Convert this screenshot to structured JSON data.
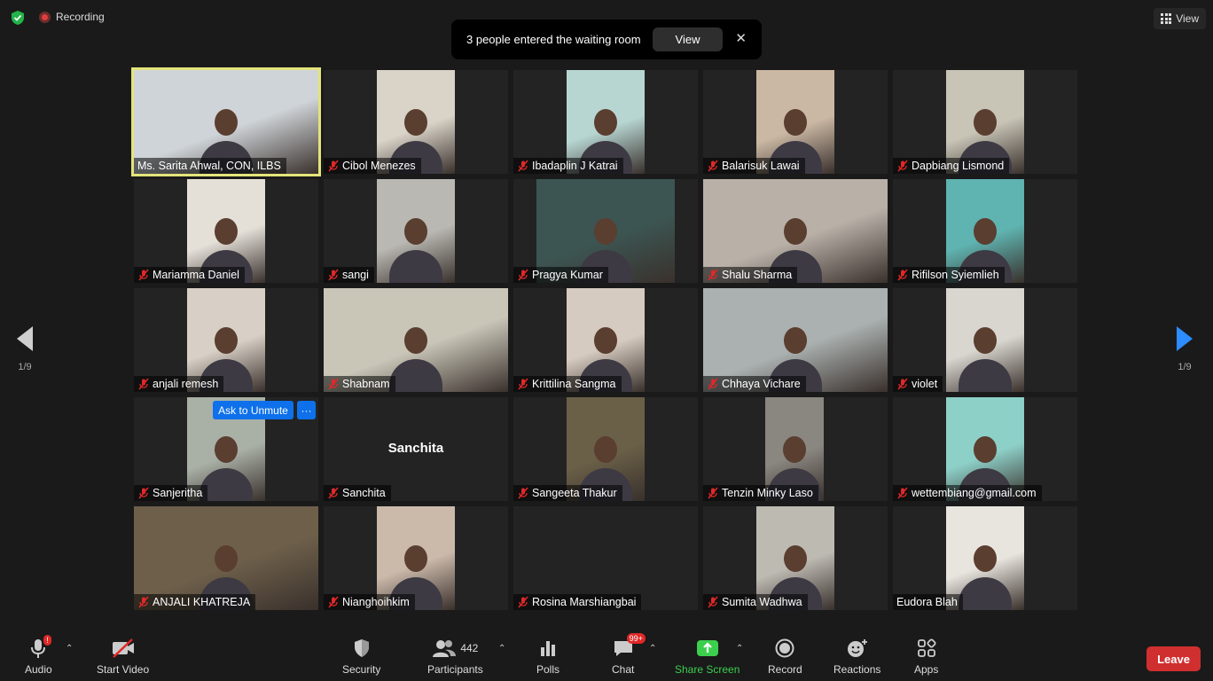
{
  "top": {
    "recording_label": "Recording",
    "view_label": "View"
  },
  "notification": {
    "text": "3 people entered the waiting room",
    "view_button": "View",
    "close_glyph": "✕"
  },
  "participants": [
    {
      "name": "Ms. Sarita Ahwal, CON, ILBS",
      "muted": false,
      "active_speaker": true,
      "feed_color": "#cfd4d8"
    },
    {
      "name": "Cibol Menezes",
      "muted": true,
      "feed_color": "#d9d3c8"
    },
    {
      "name": "Ibadaplin J Katrai",
      "muted": true,
      "feed_color": "#b7d6d2"
    },
    {
      "name": "Balarisuk Lawai",
      "muted": true,
      "feed_color": "#cbb8a4"
    },
    {
      "name": "Dapbiang Lismond",
      "muted": true,
      "feed_color": "#c8c4b6"
    },
    {
      "name": "Mariamma Daniel",
      "muted": true,
      "feed_color": "#e4e0d8"
    },
    {
      "name": "sangi",
      "muted": true,
      "feed_color": "#b9b8b2"
    },
    {
      "name": "Pragya Kumar",
      "muted": true,
      "feed_color": "#3c5552"
    },
    {
      "name": "Shalu Sharma",
      "muted": true,
      "feed_color": "#b9b0a8"
    },
    {
      "name": "Rifilson Syiemlieh",
      "muted": true,
      "feed_color": "#5fb3b0"
    },
    {
      "name": "anjali remesh",
      "muted": true,
      "feed_color": "#d8d0c6"
    },
    {
      "name": "Shabnam",
      "muted": true,
      "feed_color": "#c9c6b8"
    },
    {
      "name": "Krittilina Sangma",
      "muted": true,
      "feed_color": "#d6cbc0"
    },
    {
      "name": "Chhaya Vichare",
      "muted": true,
      "feed_color": "#aab1b0"
    },
    {
      "name": "violet",
      "muted": true,
      "feed_color": "#d9d6d0"
    },
    {
      "name": "Sanjeritha",
      "muted": true,
      "feed_color": "#a9b0a6"
    },
    {
      "name": "Sanchita",
      "muted": true,
      "feed_color": null
    },
    {
      "name": "Sangeeta Thakur",
      "muted": true,
      "feed_color": "#6a6048"
    },
    {
      "name": "Tenzin Minky Laso",
      "muted": true,
      "feed_color": "#8a8680"
    },
    {
      "name": "wettembiang@gmail.com",
      "muted": true,
      "feed_color": "#8dd0c8"
    },
    {
      "name": "ANJALI KHATREJA",
      "muted": true,
      "feed_color": "#6d5f4a"
    },
    {
      "name": "Nianghoihkim",
      "muted": true,
      "feed_color": "#cbb9aa"
    },
    {
      "name": "Rosina Marshiangbai",
      "muted": true,
      "feed_color": null
    },
    {
      "name": "Sumita Wadhwa",
      "muted": true,
      "feed_color": "#bdbab2"
    },
    {
      "name": "Eudora Blah",
      "muted": false,
      "feed_color": "#e8e4de"
    }
  ],
  "no_video_center_name": "Sanchita",
  "hover": {
    "ask_to_unmute": "Ask to Unmute",
    "more": "···"
  },
  "pagination": {
    "left": "1/9",
    "right": "1/9"
  },
  "toolbar": {
    "audio": "Audio",
    "start_video": "Start Video",
    "security": "Security",
    "participants": "Participants",
    "participant_count": "442",
    "polls": "Polls",
    "chat": "Chat",
    "chat_badge": "99+",
    "audio_badge": "!",
    "share_screen": "Share Screen",
    "record": "Record",
    "reactions": "Reactions",
    "apps": "Apps",
    "leave": "Leave"
  },
  "colors": {
    "accent_blue": "#0e71eb",
    "share_green": "#3ccf4e",
    "leave_red": "#d02f2f",
    "active_speaker_border": "#e3e47b"
  }
}
